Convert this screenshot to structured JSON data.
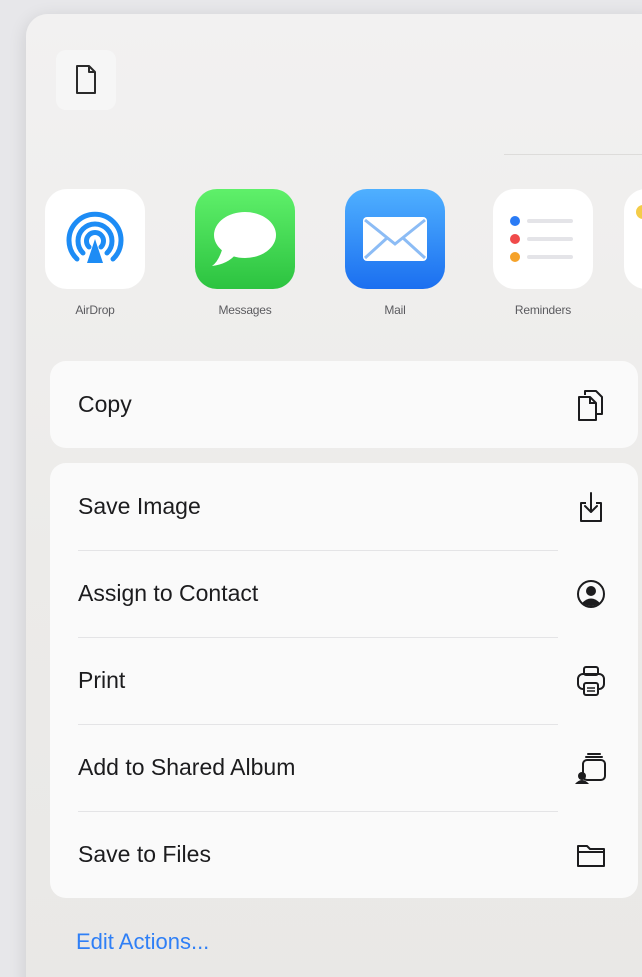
{
  "header": {
    "document_icon": "doc-icon"
  },
  "apps": [
    {
      "label": "AirDrop",
      "icon": "airdrop-icon"
    },
    {
      "label": "Messages",
      "icon": "messages-icon"
    },
    {
      "label": "Mail",
      "icon": "mail-icon"
    },
    {
      "label": "Reminders",
      "icon": "reminders-icon"
    }
  ],
  "actions_primary": [
    {
      "label": "Copy",
      "icon": "copy-icon"
    }
  ],
  "actions": [
    {
      "label": "Save Image",
      "icon": "save-image-icon"
    },
    {
      "label": "Assign to Contact",
      "icon": "contact-icon"
    },
    {
      "label": "Print",
      "icon": "print-icon"
    },
    {
      "label": "Add to Shared Album",
      "icon": "shared-album-icon"
    },
    {
      "label": "Save to Files",
      "icon": "folder-icon"
    }
  ],
  "footer": {
    "edit_actions_label": "Edit Actions..."
  },
  "colors": {
    "accent": "#2f7ff6",
    "messages_green": "#2cc340",
    "mail_blue": "#1b6ff0",
    "airdrop_blue": "#1d8cf5"
  }
}
